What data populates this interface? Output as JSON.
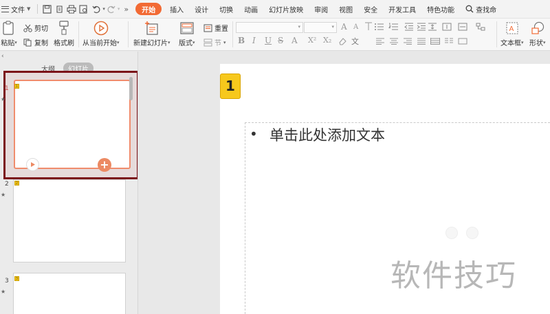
{
  "menubar": {
    "file_label": "文件",
    "tabs": [
      {
        "label": "开始",
        "active": true
      },
      {
        "label": "插入"
      },
      {
        "label": "设计"
      },
      {
        "label": "切换"
      },
      {
        "label": "动画"
      },
      {
        "label": "幻灯片放映"
      },
      {
        "label": "审阅"
      },
      {
        "label": "视图"
      },
      {
        "label": "安全"
      },
      {
        "label": "开发工具"
      },
      {
        "label": "特色功能"
      }
    ],
    "search_label": "查找命",
    "more_label": "»"
  },
  "toolbar": {
    "paste_label": "粘贴",
    "cut_label": "剪切",
    "copy_label": "复制",
    "format_painter_label": "格式刷",
    "play_from_current_label": "从当前开始",
    "new_slide_label": "新建幻灯片",
    "layout_label": "版式",
    "reset_label": "重置",
    "section_label": "节",
    "textbox_label": "文本框",
    "shape_label": "形状",
    "font_grow": "A",
    "font_shrink": "A"
  },
  "left_pane": {
    "tab_outline": "大纲",
    "tab_slides": "幻灯片",
    "slides": [
      {
        "number": "1",
        "badge": "1"
      },
      {
        "number": "2",
        "badge": "2"
      },
      {
        "number": "3",
        "badge": "3"
      }
    ]
  },
  "slide": {
    "number_badge": "1",
    "bullet": "•",
    "placeholder_text": "单击此处添加文本"
  },
  "watermark": "软件技巧",
  "colors": {
    "accent": "#f26a34",
    "selection_frame": "#7b1118",
    "badge_yellow": "#f7c81c"
  }
}
